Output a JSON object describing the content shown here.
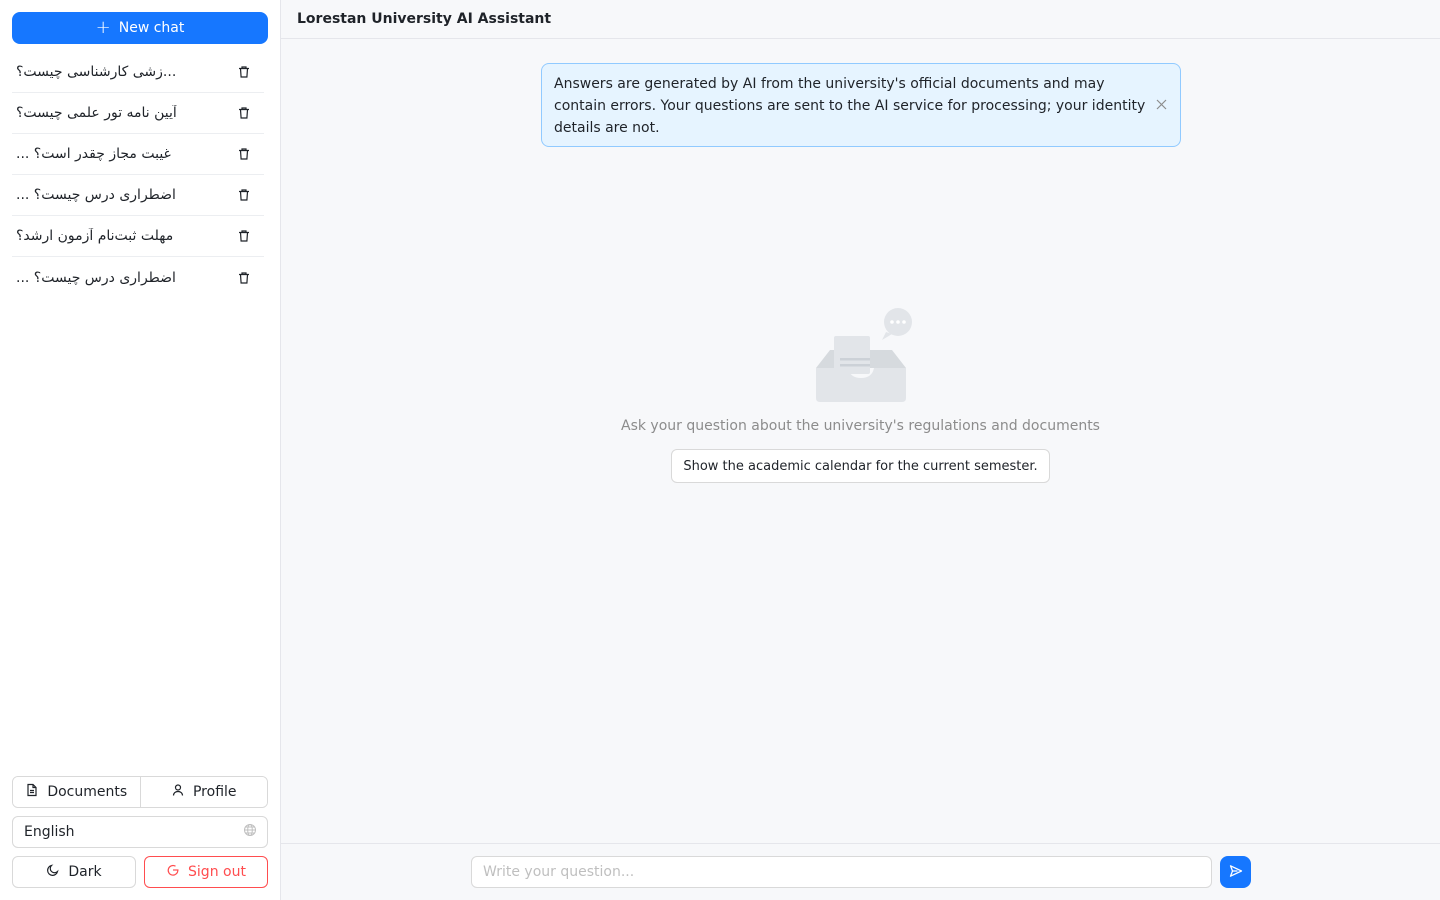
{
  "sidebar": {
    "new_chat_label": "New chat",
    "history": [
      {
        "title": "...زشی کارشناسی چیست؟"
      },
      {
        "title": "آیین نامه تور علمی چیست؟"
      },
      {
        "title": "غیبت مجاز چقدر است؟ ..."
      },
      {
        "title": "اضطراری درس چیست؟ ..."
      },
      {
        "title": "مهلت ثبت‌نام آزمون ارشد؟"
      },
      {
        "title": "اضطراری درس چیست؟ ..."
      }
    ],
    "documents_label": "Documents",
    "profile_label": "Profile",
    "language_value": "English",
    "theme_label": "Dark",
    "signout_label": "Sign out"
  },
  "header": {
    "title": "Lorestan University AI Assistant"
  },
  "notice": {
    "text": "Answers are generated by AI from the university's official documents and may contain errors. Your questions are sent to the AI service for processing; your identity details are not."
  },
  "empty_state": {
    "text": "Ask your question about the university's regulations and documents",
    "suggestion": "Show the academic calendar for the current semester."
  },
  "composer": {
    "placeholder": "Write your question..."
  },
  "colors": {
    "primary": "#1677ff",
    "danger": "#ff4d4f",
    "notice_bg": "#e6f4ff",
    "notice_border": "#91caff"
  },
  "icons": {
    "new_chat": "plus-icon",
    "delete": "trash-icon",
    "documents": "file-icon",
    "profile": "user-icon",
    "language": "globe-icon",
    "theme": "moon-icon",
    "signout": "logout-icon",
    "notice_close": "close-icon",
    "empty": "empty-inbox-chat-icon",
    "send": "send-icon"
  }
}
